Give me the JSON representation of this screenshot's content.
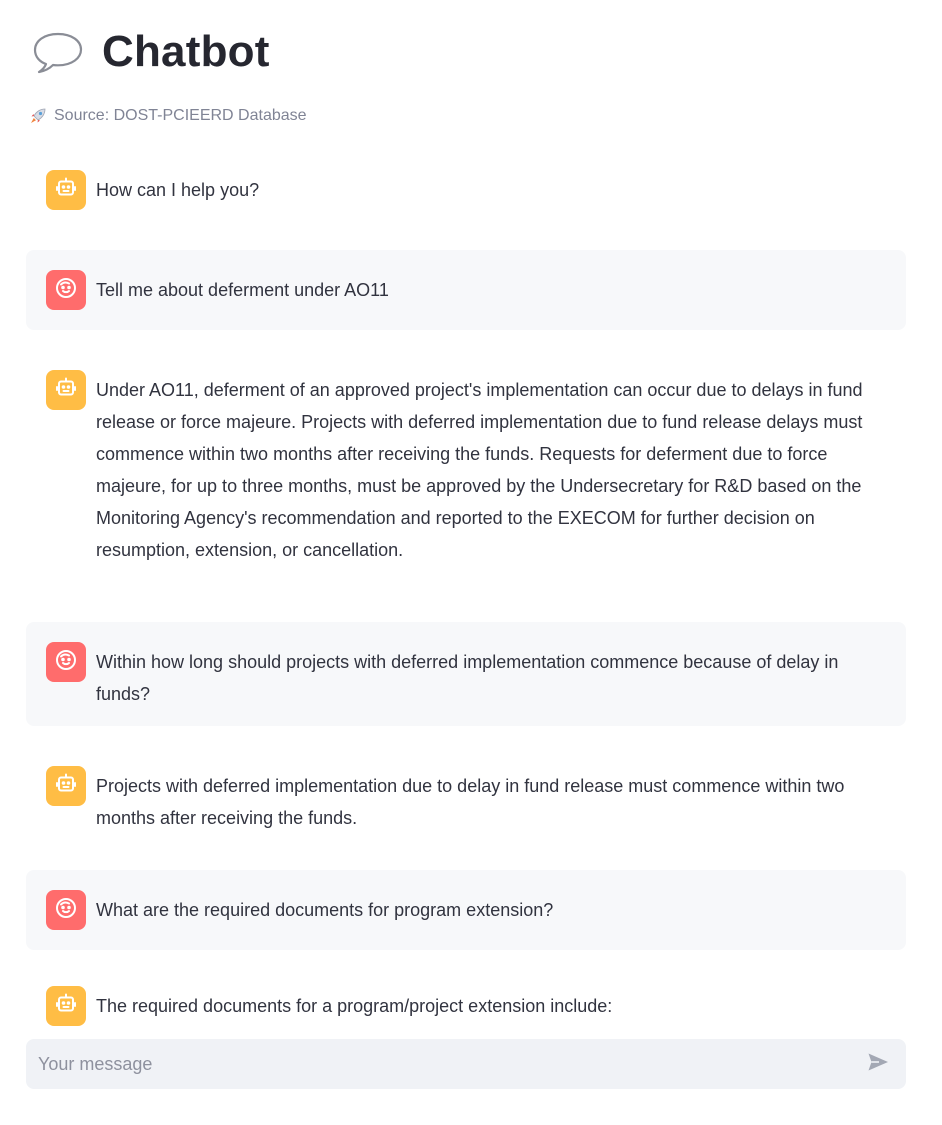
{
  "header": {
    "title": "Chatbot",
    "title_icon": "speech-bubble-icon",
    "caption": "Source: DOST-PCIEERD Database",
    "caption_icon": "rocket-icon"
  },
  "colors": {
    "assistant_avatar": "#ffbd45",
    "user_avatar": "#ff6c6c",
    "user_message_bg": "#f7f8fa",
    "input_bg": "#f0f2f6"
  },
  "messages": [
    {
      "role": "assistant",
      "avatar_icon": "robot-face-icon",
      "text": "How can I help you?"
    },
    {
      "role": "user",
      "avatar_icon": "smiling-face-icon",
      "text": "Tell me about deferment under AO11"
    },
    {
      "role": "assistant",
      "avatar_icon": "robot-face-icon",
      "text": "Under AO11, deferment of an approved project's implementation can occur due to delays in fund release or force majeure. Projects with deferred implementation due to fund release delays must commence within two months after receiving the funds. Requests for deferment due to force majeure, for up to three months, must be approved by the Undersecretary for R&D based on the Monitoring Agency's recommendation and reported to the EXECOM for further decision on resumption, extension, or cancellation."
    },
    {
      "role": "user",
      "avatar_icon": "smiling-face-icon",
      "text": "Within how long should projects with deferred implementation commence because of delay in funds?"
    },
    {
      "role": "assistant",
      "avatar_icon": "robot-face-icon",
      "text": "Projects with deferred implementation due to delay in fund release must commence within two months after receiving the funds."
    },
    {
      "role": "user",
      "avatar_icon": "smiling-face-icon",
      "text": "What are the required documents for program extension?"
    },
    {
      "role": "assistant",
      "avatar_icon": "robot-face-icon",
      "text": "The required documents for a program/project extension include:"
    }
  ],
  "chat_input": {
    "placeholder": "Your message",
    "value": "",
    "send_icon": "send-icon"
  }
}
